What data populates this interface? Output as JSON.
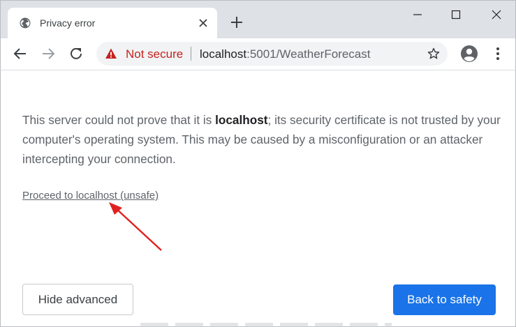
{
  "tab": {
    "title": "Privacy error",
    "favicon": "globe-icon",
    "close_icon": "close-icon"
  },
  "window_controls": [
    "minimize-icon",
    "maximize-icon",
    "close-icon"
  ],
  "toolbar": {
    "security_label": "Not secure",
    "url_host": "localhost",
    "url_path": ":5001/WeatherForecast",
    "icons": [
      "back-arrow-icon",
      "forward-arrow-icon",
      "reload-icon",
      "warning-icon",
      "star-icon",
      "profile-icon",
      "kebab-menu-icon"
    ]
  },
  "page": {
    "text_before": "This server could not prove that it is ",
    "bold_host": "localhost",
    "text_after": "; its security certificate is not trusted by your computer's operating system. This may be caused by a misconfiguration or an attacker intercepting your connection.",
    "proceed_link": "Proceed to localhost (unsafe)",
    "hide_advanced_button": "Hide advanced",
    "back_to_safety_button": "Back to safety"
  },
  "colors": {
    "not_secure": "#c5221f",
    "primary_button": "#1a73e8",
    "annotation_arrow": "#e02020"
  }
}
